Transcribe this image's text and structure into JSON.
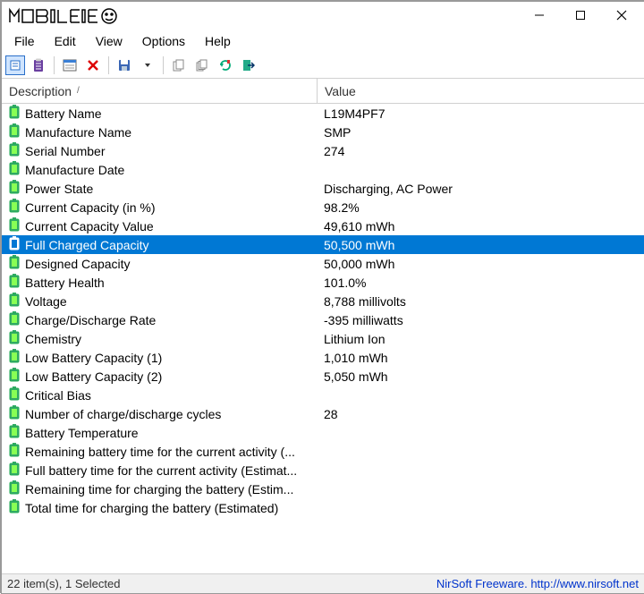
{
  "window": {
    "logo_text": "MOBILE"
  },
  "menu": {
    "file": "File",
    "edit": "Edit",
    "view": "View",
    "options": "Options",
    "help": "Help"
  },
  "columns": {
    "description": "Description",
    "value": "Value"
  },
  "rows": [
    {
      "desc": "Battery Name",
      "val": "L19M4PF7"
    },
    {
      "desc": "Manufacture Name",
      "val": "SMP"
    },
    {
      "desc": "Serial Number",
      "val": "274"
    },
    {
      "desc": "Manufacture Date",
      "val": ""
    },
    {
      "desc": "Power State",
      "val": "Discharging, AC Power"
    },
    {
      "desc": "Current Capacity (in %)",
      "val": "98.2%"
    },
    {
      "desc": "Current Capacity Value",
      "val": "49,610 mWh"
    },
    {
      "desc": "Full Charged Capacity",
      "val": "50,500 mWh",
      "selected": true
    },
    {
      "desc": "Designed Capacity",
      "val": "50,000 mWh"
    },
    {
      "desc": "Battery Health",
      "val": "101.0%"
    },
    {
      "desc": "Voltage",
      "val": "8,788 millivolts"
    },
    {
      "desc": "Charge/Discharge Rate",
      "val": "-395 milliwatts"
    },
    {
      "desc": "Chemistry",
      "val": "Lithium Ion"
    },
    {
      "desc": "Low Battery Capacity (1)",
      "val": "1,010 mWh"
    },
    {
      "desc": "Low Battery Capacity (2)",
      "val": "5,050 mWh"
    },
    {
      "desc": "Critical Bias",
      "val": ""
    },
    {
      "desc": "Number of charge/discharge cycles",
      "val": "28"
    },
    {
      "desc": "Battery Temperature",
      "val": ""
    },
    {
      "desc": "Remaining battery time for the current activity (...",
      "val": ""
    },
    {
      "desc": "Full battery time for the current activity (Estimat...",
      "val": ""
    },
    {
      "desc": "Remaining time for charging the battery (Estim...",
      "val": ""
    },
    {
      "desc": "Total  time for charging the battery (Estimated)",
      "val": ""
    }
  ],
  "status": {
    "left": "22 item(s), 1 Selected",
    "right": "NirSoft Freeware.  http://www.nirsoft.net"
  }
}
